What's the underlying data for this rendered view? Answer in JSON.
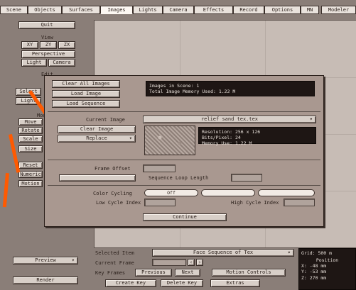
{
  "tabs": [
    "Scene",
    "Objects",
    "Surfaces",
    "Images",
    "Lights",
    "Camera",
    "Effects",
    "Record",
    "Options",
    "MN",
    "Modeler"
  ],
  "active_tab": "Images",
  "left_panel": {
    "quit": "Quit",
    "view_label": "View",
    "view_buttons": [
      "XY",
      "ZY",
      "ZX"
    ],
    "perspective": "Perspective",
    "light": "Light",
    "camera": "Camera",
    "edit_label": "Edit",
    "edit_buttons": [
      "Select",
      "Light"
    ],
    "mode_label": "Mode",
    "mode_buttons": [
      "Move",
      "Rotate",
      "Scale",
      "Size"
    ],
    "reset_buttons": [
      "Reset",
      "Numeric",
      "Motion"
    ],
    "preview": "Preview",
    "render": "Render"
  },
  "dialog": {
    "clear_all": "Clear All Images",
    "load_image": "Load Image",
    "load_sequence": "Load Sequence",
    "info_line1": "Images in Scene:        1",
    "info_line2": "Total Image Memory Used: 1.22 M",
    "current_image_label": "Current Image",
    "current_image_value": "relief sand tex.tex",
    "clear_image": "Clear Image",
    "replace": "Replace",
    "stat1": "Resolution: 256 x 126",
    "stat2": "Bits/Pixel: 24",
    "stat3": "Memory Use: 1.22 M",
    "frame_offset_label": "Frame Offset",
    "frame_offset_value": "",
    "sequence_length_label": "Sequence Loop Length",
    "color_cycling_label": "Color Cycling",
    "cycle_options": [
      "Off",
      "",
      ""
    ],
    "low_cycle_label": "Low Cycle Index",
    "high_cycle_label": "High Cycle Index",
    "continue": "Continue"
  },
  "bottom": {
    "selected_item_label": "Selected Item",
    "selected_item_value": "Face Sequence of Tex",
    "current_frame_label": "Current Frame",
    "key_frames_label": "Key Frames",
    "previous": "Previous",
    "next": "Next",
    "motion_controls": "Motion Controls",
    "create_key": "Create Key",
    "delete_key": "Delete Key",
    "extras": "Extras",
    "grid": "Grid: 500 m",
    "position": "Position",
    "pos_values": [
      "X: -48 mm",
      "Y: -53 mm",
      "Z: 270 mm"
    ]
  },
  "colors": {
    "accent": "#ff5a00",
    "panel": "#a99890",
    "dark_info": "#1e1614"
  }
}
